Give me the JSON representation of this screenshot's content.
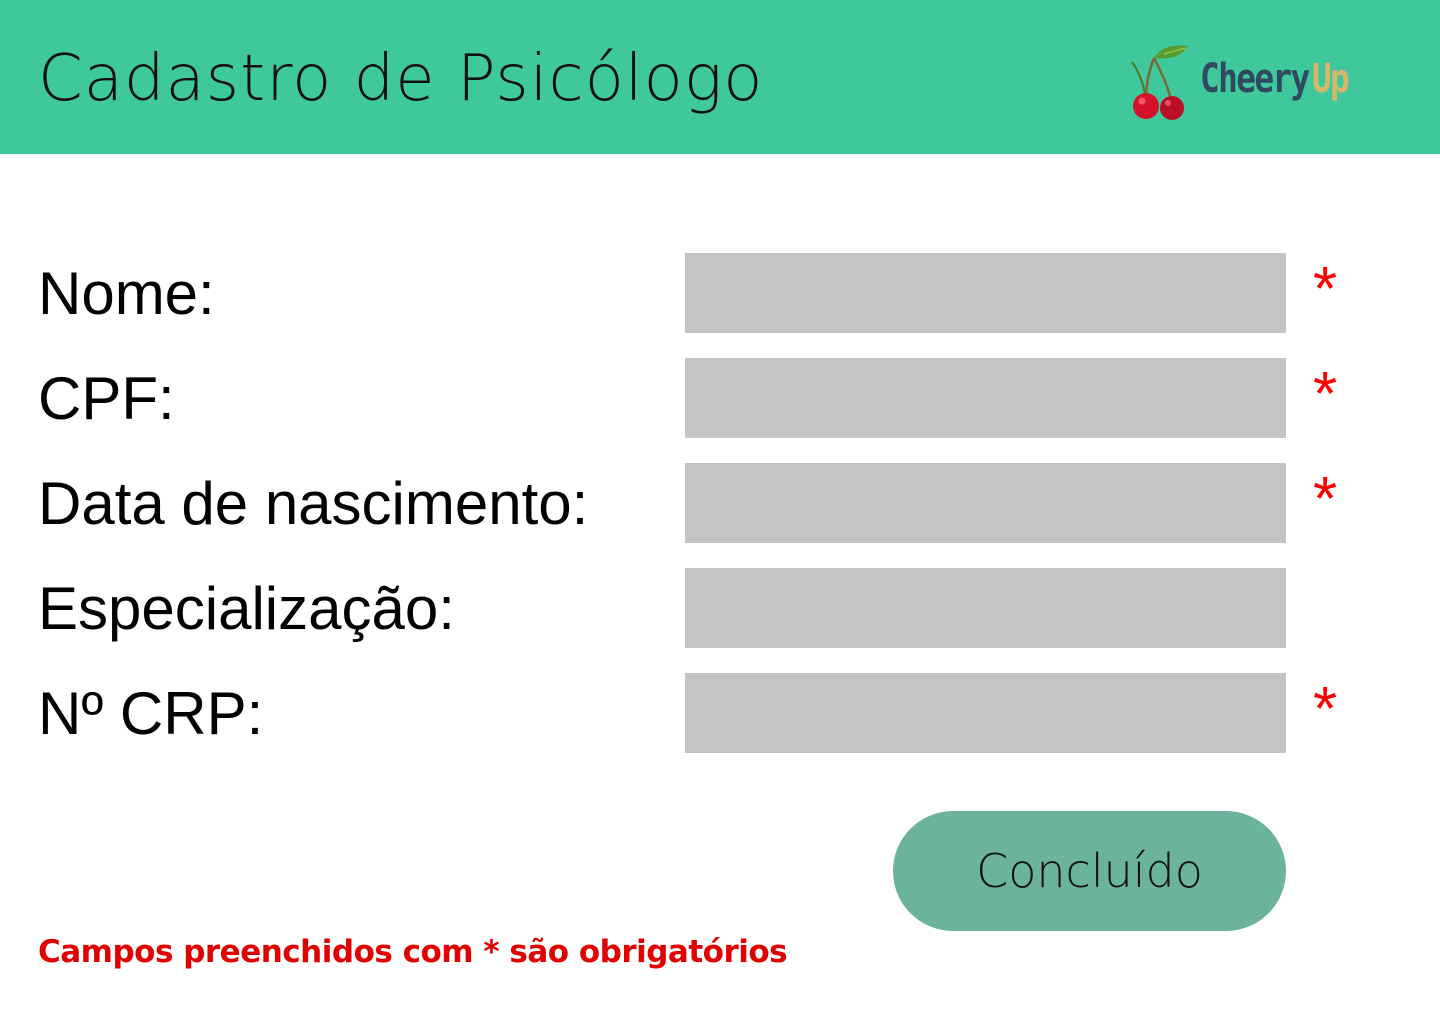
{
  "header": {
    "title": "Cadastro de Psicólogo",
    "background_color": "#3ec89c",
    "logo": {
      "icon": "cherry-icon",
      "text_part1": "Cheery",
      "text_part2": "Up"
    }
  },
  "form": {
    "fields": [
      {
        "label": "Nome:",
        "value": "",
        "required": true,
        "required_mark": "*"
      },
      {
        "label": "CPF:",
        "value": "",
        "required": true,
        "required_mark": "*"
      },
      {
        "label": "Data de nascimento:",
        "value": "",
        "required": true,
        "required_mark": "*"
      },
      {
        "label": "Especialização:",
        "value": "",
        "required": false,
        "required_mark": ""
      },
      {
        "label": "Nº CRP:",
        "value": "",
        "required": true,
        "required_mark": "*"
      }
    ],
    "input_color": "#c4c4c4",
    "required_color": "#ff0000"
  },
  "actions": {
    "done_label": "Concluído",
    "button_color": "#6bb39b"
  },
  "footer": {
    "required_note": "Campos preenchidos com * são obrigatórios",
    "note_color": "#e00000"
  }
}
